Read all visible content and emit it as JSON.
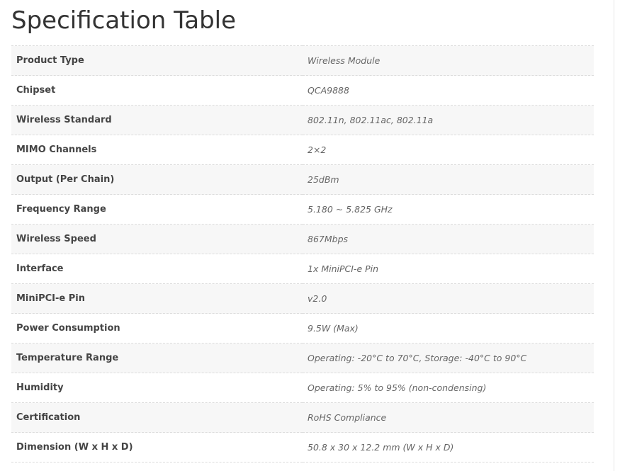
{
  "page": {
    "title": "Specification Table"
  },
  "spec_table": {
    "rows": [
      {
        "label": "Product Type",
        "value": "Wireless Module"
      },
      {
        "label": "Chipset",
        "value": "QCA9888"
      },
      {
        "label": "Wireless Standard",
        "value": "802.11n, 802.11ac, 802.11a"
      },
      {
        "label": "MIMO Channels",
        "value": "2×2"
      },
      {
        "label": "Output (Per Chain)",
        "value": "25dBm"
      },
      {
        "label": "Frequency Range",
        "value": "5.180 ~ 5.825 GHz"
      },
      {
        "label": "Wireless Speed",
        "value": "867Mbps"
      },
      {
        "label": "Interface",
        "value": "1x MiniPCI-e Pin"
      },
      {
        "label": "MiniPCI-e Pin",
        "value": "v2.0"
      },
      {
        "label": "Power Consumption",
        "value": "9.5W (Max)"
      },
      {
        "label": "Temperature Range",
        "value": "Operating: -20°C to 70°C, Storage: -40°C to 90°C"
      },
      {
        "label": "Humidity",
        "value": "Operating: 5% to 95% (non-condensing)"
      },
      {
        "label": "Certification",
        "value": "RoHS Compliance"
      },
      {
        "label": "Dimension (W x H x D)",
        "value": "50.8 x 30 x 12.2 mm (W x H x D)"
      }
    ]
  }
}
